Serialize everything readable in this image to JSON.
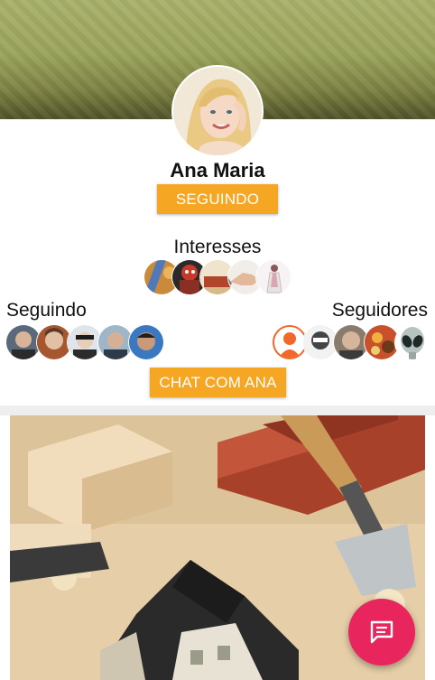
{
  "profile": {
    "name": "Ana Maria",
    "follow_button_label": "SEGUINDO",
    "chat_button_label": "CHAT COM ANA"
  },
  "interests": {
    "title": "Interesses",
    "icons": [
      "interest-art-icon",
      "interest-costume-icon",
      "interest-bricks-icon",
      "interest-handshake-icon",
      "interest-fashion-icon"
    ]
  },
  "following": {
    "title": "Seguindo",
    "avatars": [
      "user-avatar-1",
      "user-avatar-2",
      "user-avatar-3",
      "user-avatar-4",
      "user-avatar-5"
    ]
  },
  "followers": {
    "title": "Seguidores",
    "avatars": [
      "default-user-icon",
      "user-avatar-6",
      "user-avatar-7",
      "user-avatar-8",
      "alien-avatar-icon"
    ]
  },
  "post": {
    "image": "construction-tools-house-photo"
  },
  "fab": {
    "icon": "message-icon"
  },
  "colors": {
    "accent": "#f5a623",
    "fab": "#e8255d",
    "banner": "#9aa35a"
  }
}
